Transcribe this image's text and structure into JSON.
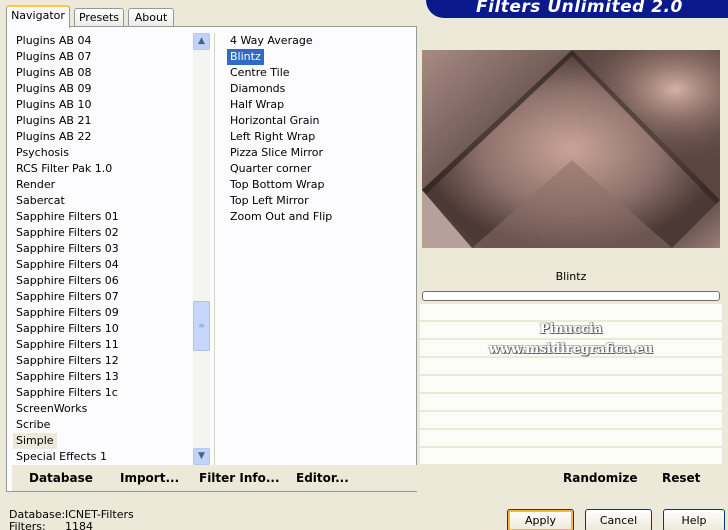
{
  "tabs": [
    {
      "label": "Navigator",
      "active": true
    },
    {
      "label": "Presets",
      "active": false
    },
    {
      "label": "About",
      "active": false
    }
  ],
  "banner": {
    "title": "Filters Unlimited 2.0"
  },
  "categories": [
    {
      "label": "Plugins AB 04"
    },
    {
      "label": "Plugins AB 07"
    },
    {
      "label": "Plugins AB 08"
    },
    {
      "label": "Plugins AB 09"
    },
    {
      "label": "Plugins AB 10"
    },
    {
      "label": "Plugins AB 21"
    },
    {
      "label": "Plugins AB 22"
    },
    {
      "label": "Psychosis"
    },
    {
      "label": "RCS Filter Pak 1.0"
    },
    {
      "label": "Render"
    },
    {
      "label": "Sabercat"
    },
    {
      "label": "Sapphire Filters 01"
    },
    {
      "label": "Sapphire Filters 02"
    },
    {
      "label": "Sapphire Filters 03"
    },
    {
      "label": "Sapphire Filters 04"
    },
    {
      "label": "Sapphire Filters 06"
    },
    {
      "label": "Sapphire Filters 07"
    },
    {
      "label": "Sapphire Filters 09"
    },
    {
      "label": "Sapphire Filters 10"
    },
    {
      "label": "Sapphire Filters 11"
    },
    {
      "label": "Sapphire Filters 12"
    },
    {
      "label": "Sapphire Filters 13"
    },
    {
      "label": "Sapphire Filters 1c"
    },
    {
      "label": "ScreenWorks"
    },
    {
      "label": "Scribe"
    },
    {
      "label": "Simple",
      "selected": true
    },
    {
      "label": "Special Effects 1"
    }
  ],
  "filters": [
    {
      "label": "4 Way Average"
    },
    {
      "label": "Blintz",
      "selected": true
    },
    {
      "label": "Centre Tile"
    },
    {
      "label": "Diamonds"
    },
    {
      "label": "Half Wrap"
    },
    {
      "label": "Horizontal Grain"
    },
    {
      "label": "Left Right Wrap"
    },
    {
      "label": "Pizza Slice Mirror"
    },
    {
      "label": "Quarter corner"
    },
    {
      "label": "Top Bottom Wrap"
    },
    {
      "label": "Top Left Mirror"
    },
    {
      "label": "Zoom Out and Flip"
    }
  ],
  "scrollbar": {
    "up_icon": "▲",
    "down_icon": "▼",
    "thumb_grip": "≡",
    "position": 0.72
  },
  "left_toolbar": {
    "database": "Database",
    "import": "Import...",
    "filter_info": "Filter Info...",
    "editor": "Editor..."
  },
  "preview": {
    "selected_filter": "Blintz"
  },
  "watermark": {
    "line1": "Pinuccia",
    "line2": "www.msidiregrafica.eu"
  },
  "right_toolbar": {
    "randomize": "Randomize",
    "reset": "Reset"
  },
  "status": {
    "database_label": "Database:",
    "database_value": "ICNET-Filters",
    "filters_label": "Filters:",
    "filters_value": "1184"
  },
  "buttons": {
    "apply": "Apply",
    "cancel": "Cancel",
    "help": "Help"
  },
  "colors": {
    "selection": "#316ac5",
    "banner": "#0a1a8c",
    "apply_focus": "#f8b636"
  }
}
